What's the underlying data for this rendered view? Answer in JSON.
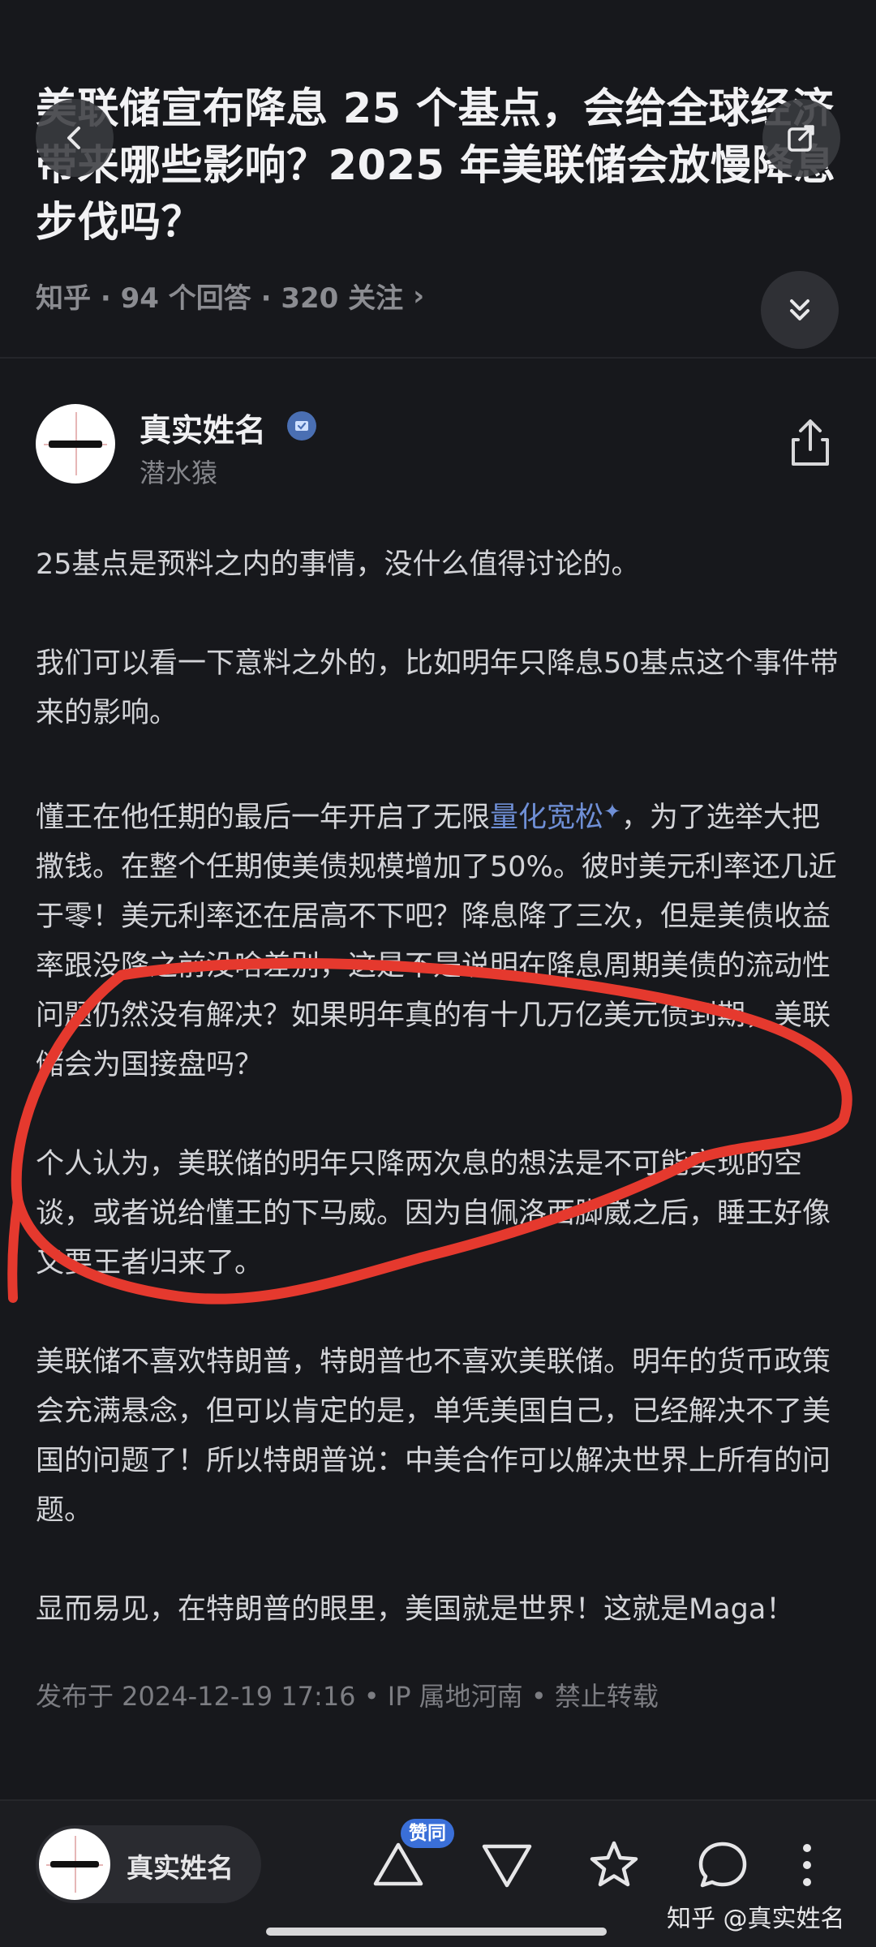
{
  "question": {
    "title": "美联储宣布降息 25 个基点，会给全球经济带来哪些影响？2025 年美联储会放慢降息步伐吗？",
    "meta": "知乎 · 94 个回答 · 320 关注",
    "meta_chevron": "›"
  },
  "author": {
    "name": "真实姓名",
    "subtitle": "潜水猿"
  },
  "answer": {
    "p1": "25基点是预料之内的事情，没什么值得讨论的。",
    "p2": "我们可以看一下意料之外的，比如明年只降息50基点这个事件带来的影响。",
    "p3_before": "懂王在他任期的最后一年开启了无限",
    "p3_link": "量化宽松",
    "p3_sparkle": "✦",
    "p3_after": "，为了选举大把撒钱。在整个任期使美债规模增加了50%。彼时美元利率还几近于零！美元利率还在居高不下吧？降息降了三次，但是美债收益率跟没降之前没啥差别，这是不是说明在降息周期美债的流动性问题仍然没有解决？如果明年真的有十几万亿美元债到期，美联储会为国接盘吗？",
    "p4": "个人认为，美联储的明年只降两次息的想法是不可能实现的空谈，或者说给懂王的下马威。因为自佩洛西脚崴之后，睡王好像又要王者归来了。",
    "p5": "美联储不喜欢特朗普，特朗普也不喜欢美联储。明年的货币政策会充满悬念，但可以肯定的是，单凭美国自己，已经解决不了美国的问题了！所以特朗普说：中美合作可以解决世界上所有的问题。",
    "p6": "显而易见，在特朗普的眼里，美国就是世界！这就是Maga！",
    "post_meta": "发布于 2024-12-19 17:16 • IP 属地河南 • 禁止转载"
  },
  "bottom_bar": {
    "author_name": "真实姓名",
    "agree_badge": "赞同",
    "watermark": "知乎 @真实姓名"
  },
  "colors": {
    "background": "#17181c",
    "link": "#6f8fd6",
    "annotation": "#e5392e",
    "badge": "#3a6fd8"
  },
  "icons": [
    "back-arrow-icon",
    "external-link-icon",
    "collapse-icon",
    "verified-icon",
    "share-icon",
    "upvote-icon",
    "downvote-icon",
    "star-icon",
    "comment-icon",
    "more-icon"
  ]
}
